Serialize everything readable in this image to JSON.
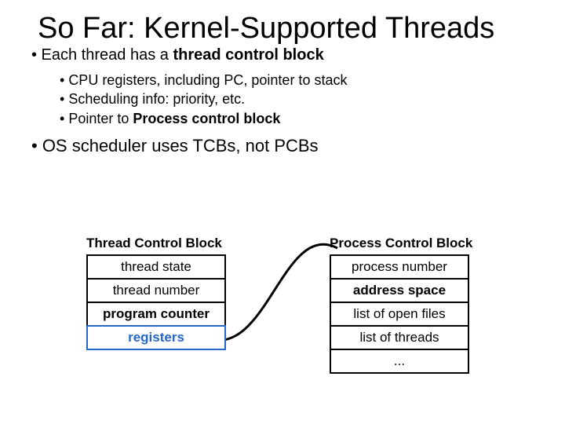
{
  "title": "So Far: Kernel-Supported Threads",
  "bullet1_pre": "• Each thread has a ",
  "bullet1_bold": "thread control block",
  "sub": {
    "a": "CPU registers, including PC, pointer to stack",
    "b": "Scheduling info: priority, etc.",
    "c_pre": "Pointer to ",
    "c_bold": "Process control block"
  },
  "bullet2": "• OS scheduler uses TCBs, not PCBs",
  "tcb": {
    "title": "Thread Control Block",
    "r1": "thread state",
    "r2": "thread number",
    "r3": "program counter",
    "r4": "registers"
  },
  "pcb": {
    "title": "Process Control Block",
    "r1": "process number",
    "r2": "address space",
    "r3": "list of open files",
    "r4": "list of threads",
    "r5": "..."
  }
}
